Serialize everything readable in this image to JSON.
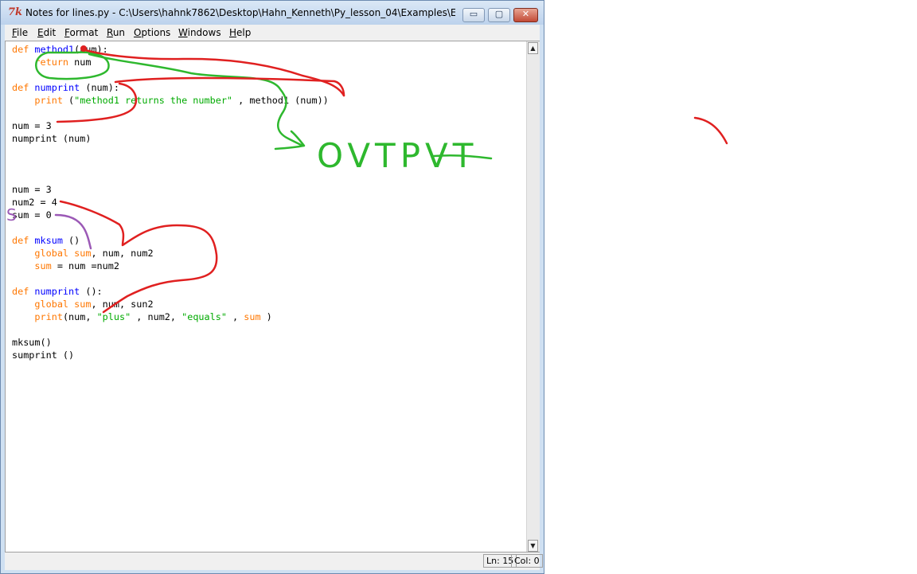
{
  "window": {
    "title": "Notes for lines.py - C:\\Users\\hahnk7862\\Desktop\\Hahn_Kenneth\\Py_lesson_04\\Examples\\Evernote lin...",
    "controls": {
      "minimize": "▭",
      "maximize": "▢",
      "close": "✕"
    }
  },
  "menubar": [
    "File",
    "Edit",
    "Format",
    "Run",
    "Options",
    "Windows",
    "Help"
  ],
  "code": [
    [
      {
        "t": "def ",
        "c": "kw"
      },
      {
        "t": "method1",
        "c": "def"
      },
      {
        "t": "(num):"
      }
    ],
    [
      {
        "t": "    "
      },
      {
        "t": "return",
        "c": "kw"
      },
      {
        "t": " num"
      }
    ],
    [],
    [
      {
        "t": "def ",
        "c": "kw"
      },
      {
        "t": "numprint",
        "c": "def"
      },
      {
        "t": " (num):"
      }
    ],
    [
      {
        "t": "    "
      },
      {
        "t": "print",
        "c": "kw"
      },
      {
        "t": " ("
      },
      {
        "t": "\"method1 returns the number\"",
        "c": "str"
      },
      {
        "t": " , method1 (num))"
      }
    ],
    [],
    [
      {
        "t": "num = 3"
      }
    ],
    [
      {
        "t": "numprint (num)"
      }
    ],
    [],
    [],
    [],
    [
      {
        "t": "num = 3"
      }
    ],
    [
      {
        "t": "num2 = 4"
      }
    ],
    [
      {
        "t": "sum = 0"
      }
    ],
    [],
    [
      {
        "t": "def ",
        "c": "kw"
      },
      {
        "t": "mksum",
        "c": "def"
      },
      {
        "t": " ()"
      }
    ],
    [
      {
        "t": "    "
      },
      {
        "t": "global",
        "c": "kw"
      },
      {
        "t": " "
      },
      {
        "t": "sum",
        "c": "kw"
      },
      {
        "t": ", num, num2"
      }
    ],
    [
      {
        "t": "    "
      },
      {
        "t": "sum",
        "c": "kw"
      },
      {
        "t": " = num =num2"
      }
    ],
    [],
    [
      {
        "t": "def ",
        "c": "kw"
      },
      {
        "t": "numprint",
        "c": "def"
      },
      {
        "t": " ():"
      }
    ],
    [
      {
        "t": "    "
      },
      {
        "t": "global",
        "c": "kw"
      },
      {
        "t": " "
      },
      {
        "t": "sum",
        "c": "kw"
      },
      {
        "t": ", num, sun2"
      }
    ],
    [
      {
        "t": "    "
      },
      {
        "t": "print",
        "c": "kw"
      },
      {
        "t": "(num, "
      },
      {
        "t": "\"plus\"",
        "c": "str"
      },
      {
        "t": " , num2, "
      },
      {
        "t": "\"equals\"",
        "c": "str"
      },
      {
        "t": " , "
      },
      {
        "t": "sum",
        "c": "kw"
      },
      {
        "t": " )"
      }
    ],
    [],
    [
      {
        "t": "mksum()"
      }
    ],
    [
      {
        "t": "sumprint ()"
      }
    ]
  ],
  "scrollbar": {
    "up": "▲",
    "down": "▼"
  },
  "status": {
    "line": "Ln: 15",
    "col": "Col: 0"
  },
  "annotations": {
    "output_label": "OVTPVT",
    "letter": "S",
    "colors": {
      "red": "#e02020",
      "green": "#2eb82e",
      "purple": "#9b59b6"
    }
  }
}
